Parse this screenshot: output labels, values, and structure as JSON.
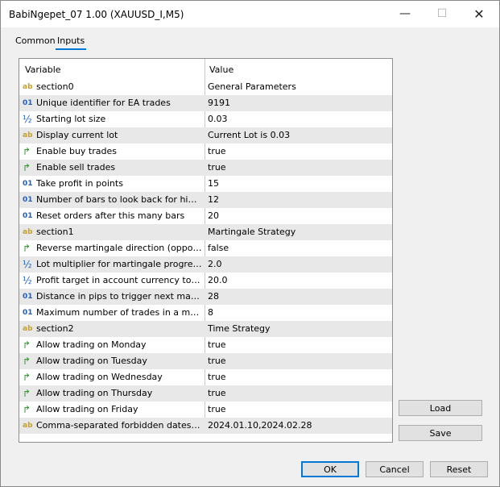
{
  "window": {
    "title": "BabiNgepet_07 1.00 (XAUUSD_I,M5)"
  },
  "tabs": [
    {
      "label": "Common"
    },
    {
      "label": "Inputs"
    }
  ],
  "table": {
    "headers": {
      "variable": "Variable",
      "value": "Value"
    },
    "rows": [
      {
        "icon": "ab",
        "type": "string",
        "variable": "section0",
        "value": "General Parameters"
      },
      {
        "icon": "01",
        "type": "int",
        "variable": "Unique identifier for EA trades",
        "value": "9191"
      },
      {
        "icon": "½",
        "type": "double",
        "variable": "Starting lot size",
        "value": "0.03"
      },
      {
        "icon": "ab",
        "type": "string",
        "variable": "Display current lot",
        "value": "Current Lot is 0.03"
      },
      {
        "icon": "↱",
        "type": "bool",
        "variable": "Enable buy trades",
        "value": "true"
      },
      {
        "icon": "↱",
        "type": "bool",
        "variable": "Enable sell trades",
        "value": "true"
      },
      {
        "icon": "01",
        "type": "int",
        "variable": "Take profit in points",
        "value": "15"
      },
      {
        "icon": "01",
        "type": "int",
        "variable": "Number of bars to look back for high/lo...",
        "value": "12"
      },
      {
        "icon": "01",
        "type": "int",
        "variable": "Reset orders after this many bars",
        "value": "20"
      },
      {
        "icon": "ab",
        "type": "string",
        "variable": "section1",
        "value": "Martingale Strategy"
      },
      {
        "icon": "↱",
        "type": "bool",
        "variable": "Reverse martingale direction (opposite ...",
        "value": "false"
      },
      {
        "icon": "½",
        "type": "double",
        "variable": "Lot multiplier for martingale progression",
        "value": "2.0"
      },
      {
        "icon": "½",
        "type": "double",
        "variable": "Profit target in account currency to clos...",
        "value": "20.0"
      },
      {
        "icon": "01",
        "type": "int",
        "variable": "Distance in pips to trigger next martinga...",
        "value": "28"
      },
      {
        "icon": "01",
        "type": "int",
        "variable": "Maximum number of trades in a marting...",
        "value": "8"
      },
      {
        "icon": "ab",
        "type": "string",
        "variable": "section2",
        "value": "Time Strategy"
      },
      {
        "icon": "↱",
        "type": "bool",
        "variable": "Allow trading on Monday",
        "value": "true"
      },
      {
        "icon": "↱",
        "type": "bool",
        "variable": "Allow trading on Tuesday",
        "value": "true"
      },
      {
        "icon": "↱",
        "type": "bool",
        "variable": "Allow trading on Wednesday",
        "value": "true"
      },
      {
        "icon": "↱",
        "type": "bool",
        "variable": "Allow trading on Thursday",
        "value": "true"
      },
      {
        "icon": "↱",
        "type": "bool",
        "variable": "Allow trading on Friday",
        "value": "true"
      },
      {
        "icon": "ab",
        "type": "string",
        "variable": "Comma-separated forbidden dates (YYY...",
        "value": "2024.01.10,2024.02.28"
      }
    ]
  },
  "buttons": {
    "load": "Load",
    "save": "Save",
    "ok": "OK",
    "cancel": "Cancel",
    "reset": "Reset"
  },
  "colors": {
    "accent": "#0078d7",
    "string_icon": "#c8a02a",
    "int_icon": "#1f5fbf",
    "bool_icon": "#2a9a2a"
  }
}
